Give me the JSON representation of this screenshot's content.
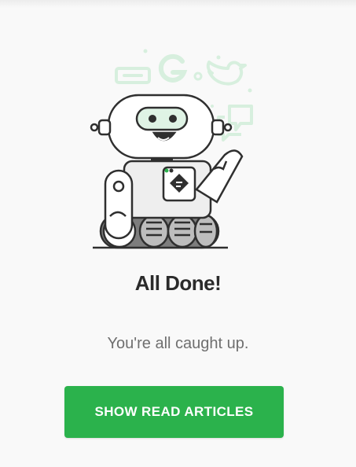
{
  "empty_state": {
    "title": "All Done!",
    "subtitle": "You're all caught up.",
    "button_label": "SHOW READ ARTICLES"
  },
  "illustration": {
    "subject": "robot-waving-icon",
    "background_icons": [
      "google-icon",
      "twitter-icon",
      "chat-bubble-icon",
      "link-card-icon"
    ],
    "badge_icon": "feedly-logo-icon"
  },
  "colors": {
    "accent": "#2bb24c",
    "accent_tint": "#dff3e5",
    "title": "#2b2b2b",
    "subtitle": "#6f6f6f",
    "background": "#f9f9f9"
  }
}
